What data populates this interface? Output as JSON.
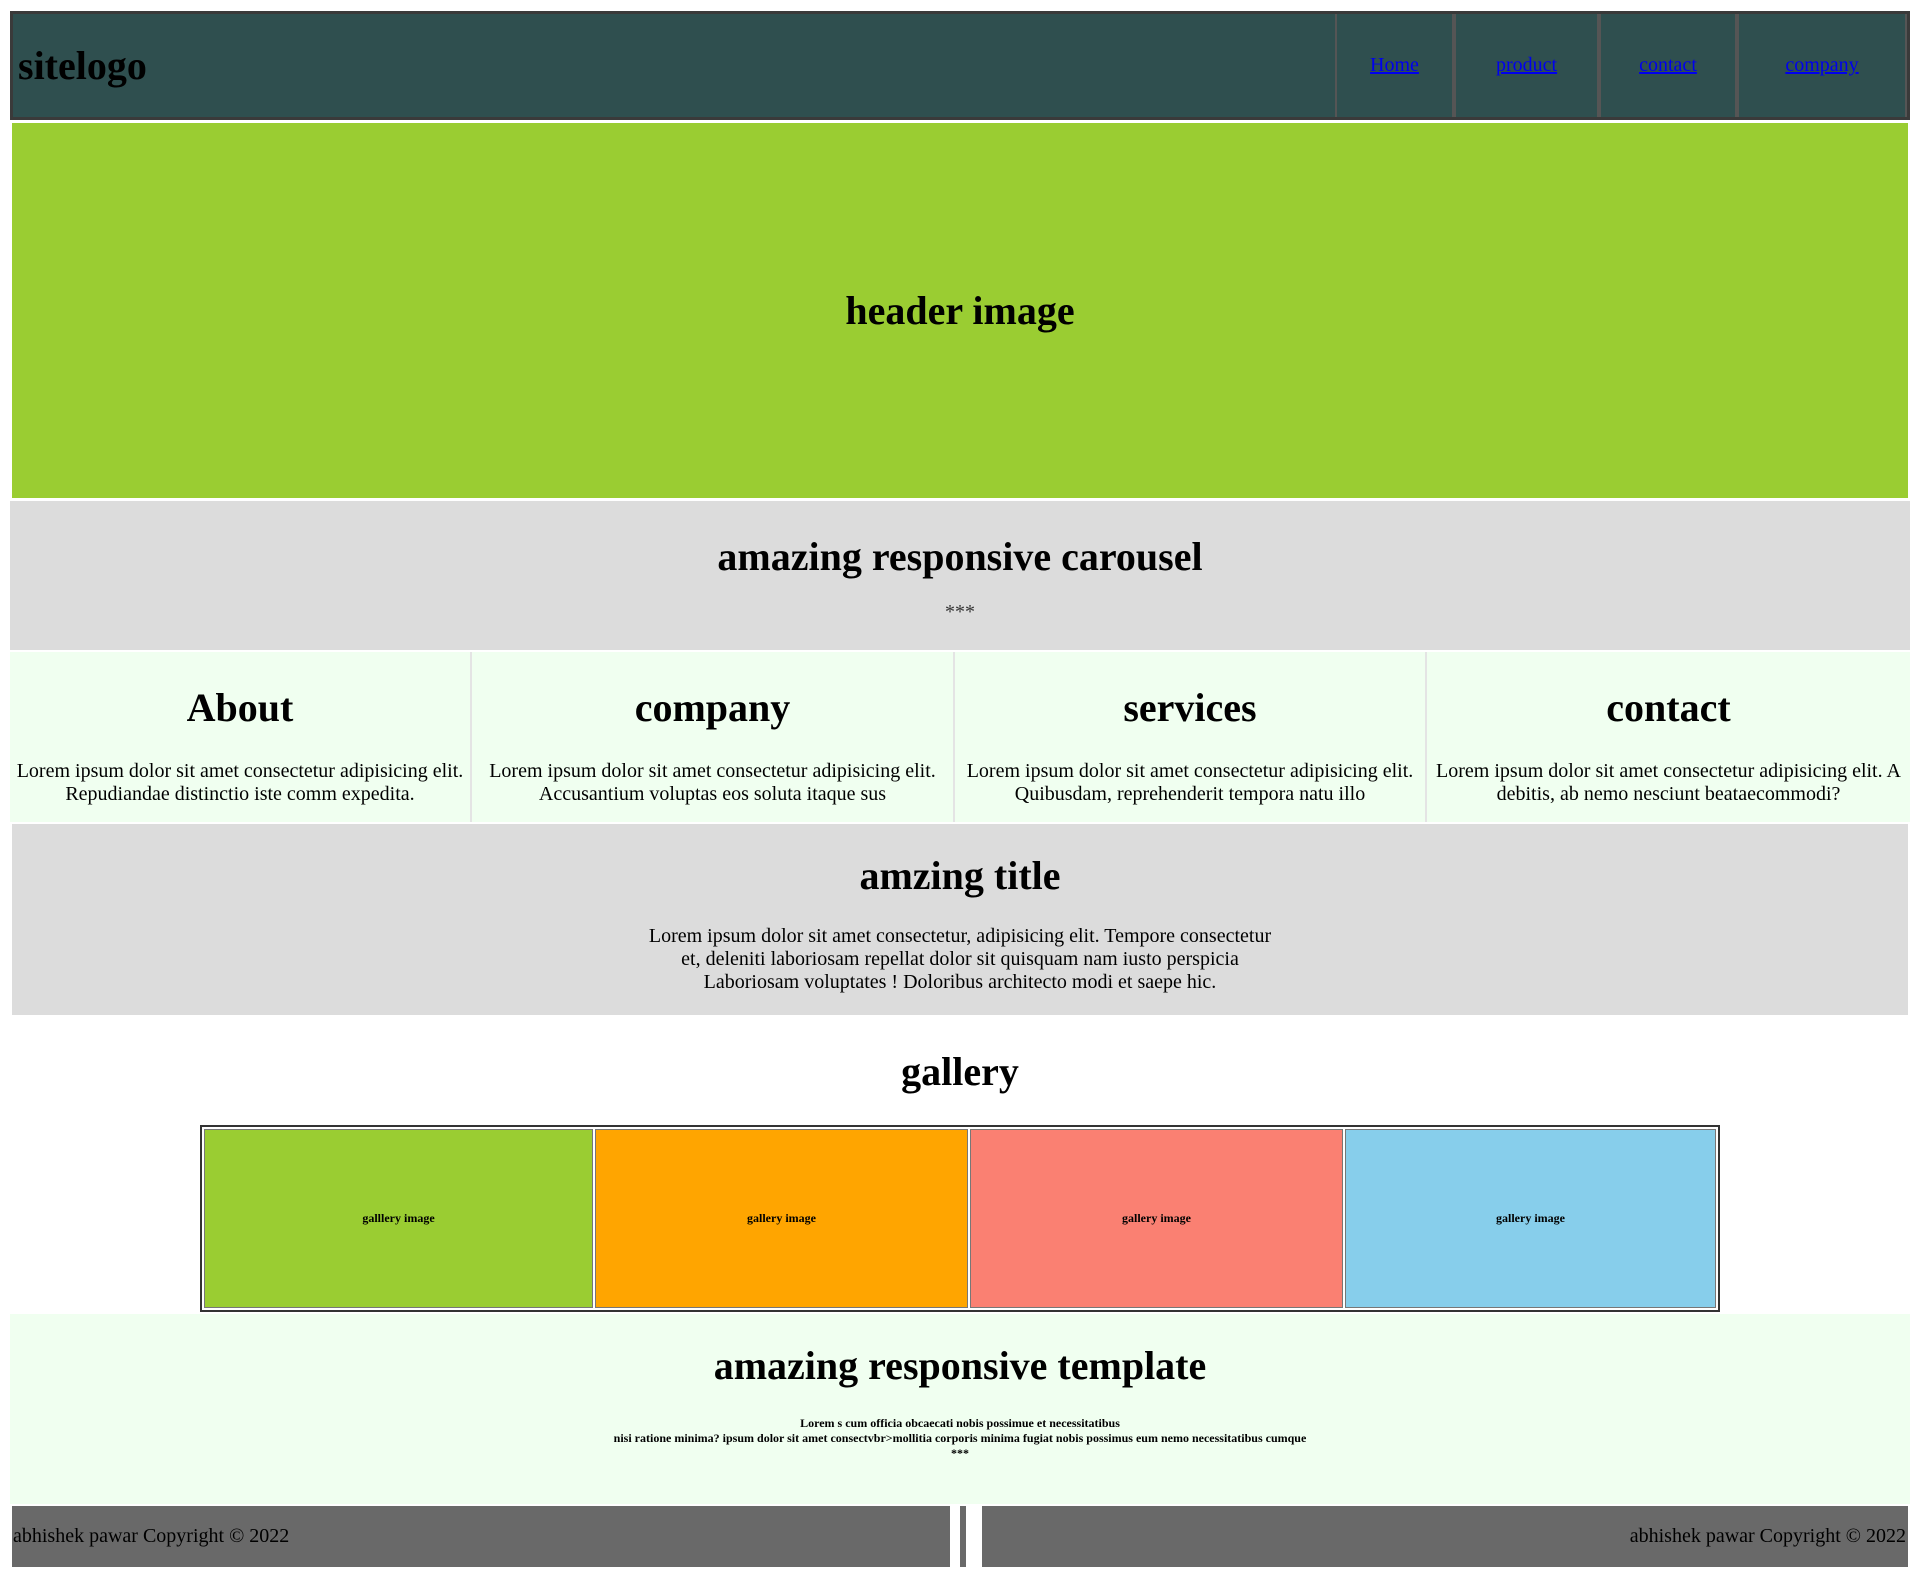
{
  "nav": {
    "logo": "sitelogo",
    "links": [
      "Home",
      "product",
      "contact",
      "company"
    ]
  },
  "hero": {
    "title": "header image"
  },
  "carousel": {
    "title": "amazing responsive carousel",
    "stars": "***"
  },
  "columns": [
    {
      "title": "About",
      "text": "Lorem ipsum dolor sit amet consectetur adipisicing elit. Repudiandae distinctio iste comm expedita."
    },
    {
      "title": "company",
      "text": "Lorem ipsum dolor sit amet consectetur adipisicing elit. Accusantium voluptas eos soluta itaque sus"
    },
    {
      "title": "services",
      "text": "Lorem ipsum dolor sit amet consectetur adipisicing elit. Quibusdam, reprehenderit tempora natu illo"
    },
    {
      "title": "contact",
      "text": "Lorem ipsum dolor sit amet consectetur adipisicing elit. A debitis, ab nemo nesciunt beataecommodi?"
    }
  ],
  "amzing": {
    "title": "amzing title",
    "text": "Lorem ipsum dolor sit amet consectetur, adipisicing elit. Tempore consectetur et, deleniti laboriosam repellat dolor sit quisquam nam iusto perspicia Laboriosam voluptates ! Doloribus architecto modi et saepe hic."
  },
  "gallery": {
    "title": "gallery",
    "images": [
      {
        "label": "galllery image",
        "color": "#9acd32"
      },
      {
        "label": "gallery image",
        "color": "#ffa500"
      },
      {
        "label": "gallery image",
        "color": "#fa8072"
      },
      {
        "label": "gallery image",
        "color": "#87ceeb"
      }
    ]
  },
  "template": {
    "title": "amazing responsive template",
    "line1": "Lorem s cum officia obcaecati nobis possimue et necessitatibus",
    "line2": "nisi ratione minima? ipsum dolor sit amet consectvbr>mollitia corporis minima fugiat nobis possimus eum nemo necessitatibus cumque",
    "stars": "***"
  },
  "footer": {
    "left": "abhishek pawar Copyright © 2022",
    "right": "abhishek pawar Copyright © 2022"
  }
}
